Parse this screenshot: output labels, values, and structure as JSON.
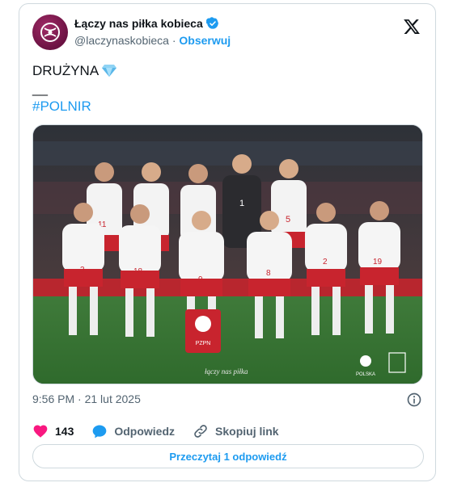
{
  "account": {
    "display_name": "Łączy nas piłka kobieca",
    "handle": "@laczynaskobieca",
    "separator": "·",
    "follow_label": "Obserwuj"
  },
  "tweet": {
    "line1": "DRUŻYNA",
    "line2": "__",
    "hashtag": "#POLNIR"
  },
  "photo": {
    "watermark": "łączy nas piłka",
    "pennant_text": "PZPN",
    "brand_text": "POLSKA",
    "players": [
      {
        "number": "11"
      },
      {
        "number": ""
      },
      {
        "number": ""
      },
      {
        "number": "1"
      },
      {
        "number": "5"
      },
      {
        "number": "3"
      },
      {
        "number": "18"
      },
      {
        "number": "9"
      },
      {
        "number": "8"
      },
      {
        "number": "2"
      },
      {
        "number": "19"
      }
    ]
  },
  "meta": {
    "time": "9:56 PM",
    "separator": "·",
    "date": "21 lut 2025"
  },
  "actions": {
    "likes": "143",
    "reply_label": "Odpowiedz",
    "copy_link_label": "Skopiuj link"
  },
  "read_replies_label": "Przeczytaj 1 odpowiedź",
  "colors": {
    "accent": "#1d9bf0",
    "like": "#f91880",
    "border": "#cfd9de",
    "muted": "#536471"
  }
}
